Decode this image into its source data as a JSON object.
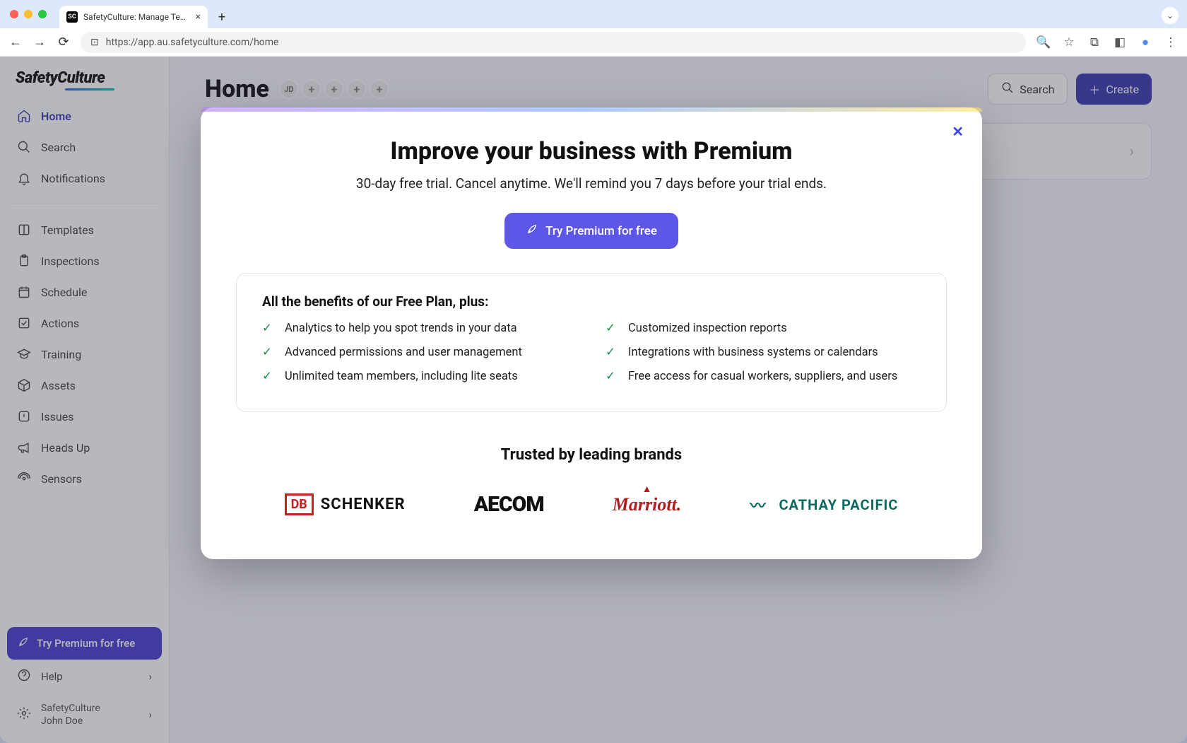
{
  "browser": {
    "tab_title": "SafetyCulture: Manage Teams and...",
    "url": "https://app.au.safetyculture.com/home"
  },
  "sidebar": {
    "logo": "SafetyCulture",
    "nav_primary": [
      {
        "label": "Home",
        "icon": "home"
      },
      {
        "label": "Search",
        "icon": "search"
      },
      {
        "label": "Notifications",
        "icon": "bell"
      }
    ],
    "nav_secondary": [
      {
        "label": "Templates",
        "icon": "template"
      },
      {
        "label": "Inspections",
        "icon": "clipboard"
      },
      {
        "label": "Schedule",
        "icon": "calendar"
      },
      {
        "label": "Actions",
        "icon": "check-square"
      },
      {
        "label": "Training",
        "icon": "graduation"
      },
      {
        "label": "Assets",
        "icon": "box"
      },
      {
        "label": "Issues",
        "icon": "alert"
      },
      {
        "label": "Heads Up",
        "icon": "megaphone"
      },
      {
        "label": "Sensors",
        "icon": "signal"
      }
    ],
    "try_premium": "Try Premium for free",
    "help": "Help",
    "org_name": "SafetyCulture",
    "user_name": "John Doe"
  },
  "header": {
    "title": "Home",
    "avatar_initials": "JD",
    "search_label": "Search",
    "create_label": "Create"
  },
  "modal": {
    "title": "Improve your business with Premium",
    "subtitle": "30-day free trial. Cancel anytime. We'll remind you 7 days before your trial ends.",
    "cta": "Try Premium for free",
    "benefits_heading": "All the benefits of our Free Plan, plus:",
    "benefits": [
      "Analytics to help you spot trends in your data",
      "Customized inspection reports",
      "Advanced permissions and user management",
      "Integrations with business systems or calendars",
      "Unlimited team members, including lite seats",
      "Free access for casual workers, suppliers, and users"
    ],
    "trusted": "Trusted by leading brands",
    "brands": {
      "db_box": "DB",
      "db_text": "SCHENKER",
      "aecom": "AECOM",
      "marriott": "Marriott.",
      "cathay": "CATHAY PACIFIC"
    }
  }
}
